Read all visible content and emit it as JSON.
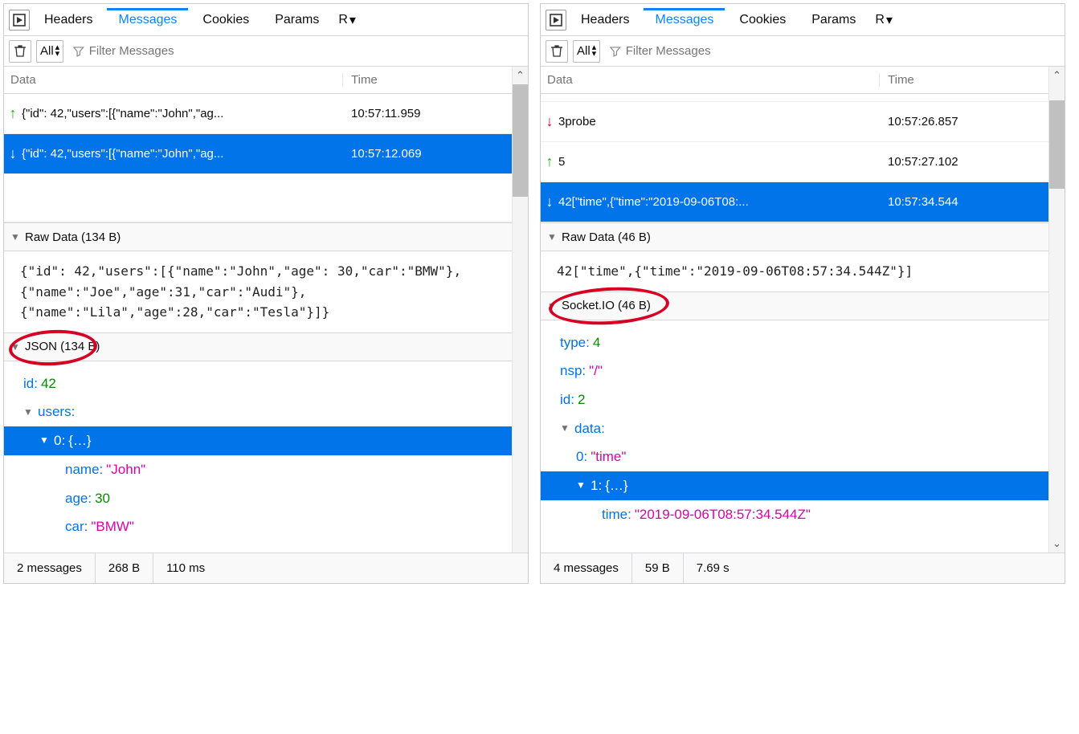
{
  "tabs": {
    "headers": "Headers",
    "messages": "Messages",
    "cookies": "Cookies",
    "params": "Params",
    "r": "R"
  },
  "toolbar": {
    "all": "All",
    "filter_placeholder": "Filter Messages"
  },
  "table": {
    "col_data": "Data",
    "col_time": "Time"
  },
  "left": {
    "rows": [
      {
        "dir": "up",
        "text": "{\"id\": 42,\"users\":[{\"name\":\"John\",\"ag...",
        "time": "10:57:11.959",
        "selected": false
      },
      {
        "dir": "down",
        "text": "{\"id\": 42,\"users\":[{\"name\":\"John\",\"ag...",
        "time": "10:57:12.069",
        "selected": true
      }
    ],
    "raw_header": "Raw Data (134 B)",
    "raw_body": "{\"id\": 42,\"users\":[{\"name\":\"John\",\"age\": 30,\"car\":\"BMW\"},\n{\"name\":\"Joe\",\"age\":31,\"car\":\"Audi\"},\n{\"name\":\"Lila\",\"age\":28,\"car\":\"Tesla\"}]}",
    "json_header": "JSON (134 B)",
    "json": {
      "id_key": "id:",
      "id_val": "42",
      "users_key": "users:",
      "item0_key": "0:",
      "item0_val": "{…}",
      "name_key": "name:",
      "name_val": "\"John\"",
      "age_key": "age:",
      "age_val": "30",
      "car_key": "car:",
      "car_val": "\"BMW\""
    },
    "status": {
      "msgs": "2 messages",
      "size": "268 B",
      "dur": "110 ms"
    }
  },
  "right": {
    "rows": [
      {
        "dir": "down",
        "text": "3probe",
        "time": "10:57:26.857",
        "selected": false
      },
      {
        "dir": "up",
        "text": "5",
        "time": "10:57:27.102",
        "selected": false
      },
      {
        "dir": "down",
        "text": "42[\"time\",{\"time\":\"2019-09-06T08:...",
        "time": "10:57:34.544",
        "selected": true
      }
    ],
    "raw_header": "Raw Data (46 B)",
    "raw_body": "42[\"time\",{\"time\":\"2019-09-06T08:57:34.544Z\"}]",
    "sio_header": "Socket.IO (46 B)",
    "sio": {
      "type_key": "type:",
      "type_val": "4",
      "nsp_key": "nsp:",
      "nsp_val": "\"/\"",
      "id_key": "id:",
      "id_val": "2",
      "data_key": "data:",
      "d0_key": "0:",
      "d0_val": "\"time\"",
      "d1_key": "1:",
      "d1_val": "{…}",
      "time_key": "time:",
      "time_val": "\"2019-09-06T08:57:34.544Z\""
    },
    "status": {
      "msgs": "4 messages",
      "size": "59 B",
      "dur": "7.69 s"
    }
  }
}
